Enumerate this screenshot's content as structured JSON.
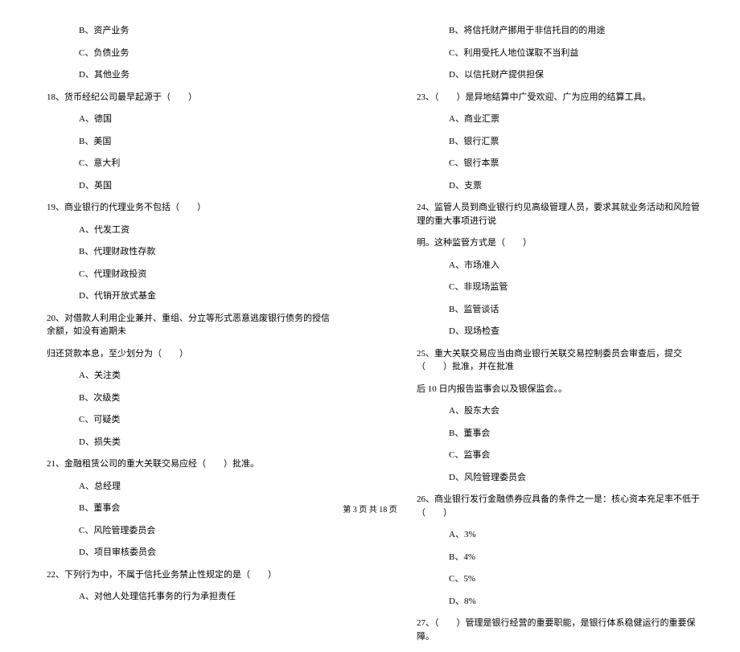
{
  "left_column": [
    {
      "type": "option",
      "text": "B、资产业务"
    },
    {
      "type": "option",
      "text": "C、负债业务"
    },
    {
      "type": "option",
      "text": "D、其他业务"
    },
    {
      "type": "question",
      "text": "18、货币经纪公司最早起源于（　　）"
    },
    {
      "type": "option",
      "text": "A、德国"
    },
    {
      "type": "option",
      "text": "B、美国"
    },
    {
      "type": "option",
      "text": "C、意大利"
    },
    {
      "type": "option",
      "text": "D、英国"
    },
    {
      "type": "question",
      "text": "19、商业银行的代理业务不包括（　　）"
    },
    {
      "type": "option",
      "text": "A、代发工资"
    },
    {
      "type": "option",
      "text": "B、代理财政性存款"
    },
    {
      "type": "option",
      "text": "C、代理财政投资"
    },
    {
      "type": "option",
      "text": "D、代销开放式基金"
    },
    {
      "type": "question",
      "text": "20、对借款人利用企业兼并、重组、分立等形式恶意逃废银行债务的授信余额，如没有逾期未"
    },
    {
      "type": "continuation",
      "text": "归还贷款本息，至少划分为（　　）"
    },
    {
      "type": "option",
      "text": "A、关注类"
    },
    {
      "type": "option",
      "text": "B、次级类"
    },
    {
      "type": "option",
      "text": "C、可疑类"
    },
    {
      "type": "option",
      "text": "D、损失类"
    },
    {
      "type": "question",
      "text": "21、金融租赁公司的重大关联交易应经（　　）批准。"
    },
    {
      "type": "option",
      "text": "A、总经理"
    },
    {
      "type": "option",
      "text": "B、董事会"
    },
    {
      "type": "option",
      "text": "C、风险管理委员会"
    },
    {
      "type": "option",
      "text": "D、项目审核委员会"
    },
    {
      "type": "question",
      "text": "22、下列行为中，不属于信托业务禁止性规定的是（　　）"
    },
    {
      "type": "option",
      "text": "A、对他人处理信托事务的行为承担责任"
    }
  ],
  "right_column": [
    {
      "type": "option",
      "text": "B、将信托财产挪用于非信托目的的用途"
    },
    {
      "type": "option",
      "text": "C、利用受托人地位谋取不当利益"
    },
    {
      "type": "option",
      "text": "D、以信托财产提供担保"
    },
    {
      "type": "question",
      "text": "23、（　　）是异地结算中广受欢迎、广为应用的结算工具。"
    },
    {
      "type": "option",
      "text": "A、商业汇票"
    },
    {
      "type": "option",
      "text": "B、银行汇票"
    },
    {
      "type": "option",
      "text": "C、银行本票"
    },
    {
      "type": "option",
      "text": "D、支票"
    },
    {
      "type": "question",
      "text": "24、监管人员到商业银行约见高级管理人员，要求其就业务活动和风险管理的重大事项进行说"
    },
    {
      "type": "continuation",
      "text": "明。这种监管方式是（　　）"
    },
    {
      "type": "option",
      "text": "A、市场准入"
    },
    {
      "type": "option",
      "text": "C、非现场监管"
    },
    {
      "type": "option",
      "text": "B、监管谈话"
    },
    {
      "type": "option",
      "text": "D、现场检查"
    },
    {
      "type": "question",
      "text": "25、重大关联交易应当由商业银行关联交易控制委员会审查后，提交（　　）批准，并在批准"
    },
    {
      "type": "continuation",
      "text": "后 10 日内报告监事会以及银保监会。。"
    },
    {
      "type": "option",
      "text": "A、股东大会"
    },
    {
      "type": "option",
      "text": "B、董事会"
    },
    {
      "type": "option",
      "text": "C、监事会"
    },
    {
      "type": "option",
      "text": "D、风险管理委员会"
    },
    {
      "type": "question",
      "text": "26、商业银行发行金融债券应具备的条件之一是：核心资本充足率不低于（　　）"
    },
    {
      "type": "option",
      "text": "A、3%"
    },
    {
      "type": "option",
      "text": "B、4%"
    },
    {
      "type": "option",
      "text": "C、5%"
    },
    {
      "type": "option",
      "text": "D、8%"
    },
    {
      "type": "question",
      "text": "27、（　　）管理是银行经营的重要职能，是银行体系稳健运行的重要保障。"
    }
  ],
  "footer": "第 3 页 共 18 页"
}
